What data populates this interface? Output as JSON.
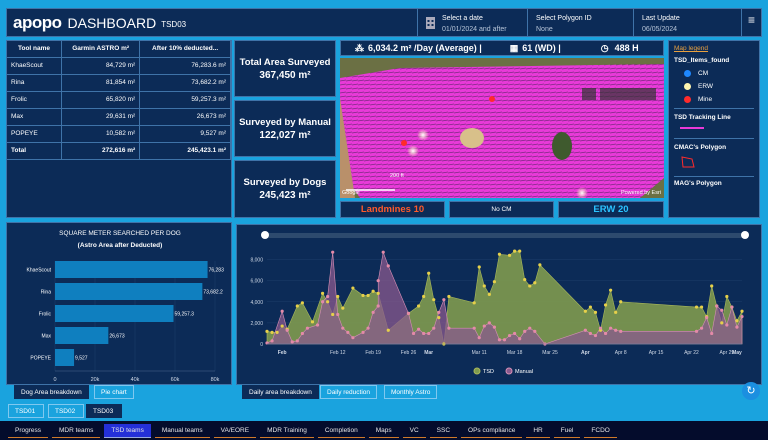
{
  "header": {
    "logo": "apopo",
    "title": "DASHBOARD",
    "subtitle": "TSD03",
    "date_label": "Select a date",
    "date_value": "01/01/2024 and after",
    "polygon_label": "Select Polygon ID",
    "polygon_value": "None",
    "update_label": "Last Update",
    "update_value": "06/05/2024"
  },
  "table": {
    "headers": [
      "Tool name",
      "Garmin ASTRO m²",
      "After 10% deducted..."
    ],
    "rows": [
      [
        "KhaeScout",
        "84,729 m²",
        "76,283.6 m²"
      ],
      [
        "Rina",
        "81,854 m²",
        "73,682.2 m²"
      ],
      [
        "Frolic",
        "65,820 m²",
        "59,257.3 m²"
      ],
      [
        "Max",
        "29,631 m²",
        "26,673 m²"
      ],
      [
        "POPEYE",
        "10,582 m²",
        "9,527 m²"
      ]
    ],
    "total": [
      "Total",
      "272,616 m²",
      "245,423.1 m²"
    ]
  },
  "kpis": [
    {
      "label": "Total Area Surveyed",
      "value": "367,450 m²"
    },
    {
      "label": "Surveyed by Manual",
      "value": "122,027 m²"
    },
    {
      "label": "Surveyed by Dogs",
      "value": "245,423 m²"
    }
  ],
  "stats": {
    "avg": "6,034.2 m² /Day (Average) |",
    "wd": "61 (WD) |",
    "hours": "488 H"
  },
  "map": {
    "scale": "200 ft",
    "attribution_left": "Google",
    "attribution_right": "Powered by Esri"
  },
  "counters": {
    "landmines": "Landmines 10",
    "cm": "No CM",
    "erw": "ERW 20",
    "landmine_color": "#ff5a2a",
    "erw_color": "#2bc2ff"
  },
  "legend": {
    "title": "Map legend",
    "items_title": "TSD_Items_found",
    "items": [
      {
        "label": "CM",
        "color": "#1e88ff"
      },
      {
        "label": "ERW",
        "color": "#fff6b0"
      },
      {
        "label": "Mine",
        "color": "#ff2b2b"
      }
    ],
    "tracking_title": "TSD Tracking Line",
    "polygon_title": "CMAC's Polygon",
    "next_title": "MAG's Polygon"
  },
  "chart_data": [
    {
      "type": "bar",
      "title": "SQUARE METER SEARCHED PER DOG",
      "subtitle": "(Astro Area after Deducted)",
      "categories": [
        "KhaeScout",
        "Rina",
        "Frolic",
        "Max",
        "POPEYE"
      ],
      "values": [
        76283,
        73682.2,
        59257.3,
        26673,
        9527
      ],
      "value_labels": [
        "76,283",
        "73,682.2",
        "59,257.3",
        "26,673",
        "9,527"
      ],
      "xlim": [
        0,
        80000
      ],
      "ticks": [
        "0",
        "20k",
        "40k",
        "60k",
        "80k"
      ],
      "orientation": "horizontal",
      "color": "#0f7fbf"
    },
    {
      "type": "area",
      "xlim": [
        "2024-01-29",
        "2024-05-02"
      ],
      "ylim": [
        0,
        9000
      ],
      "yticks": [
        "0",
        "2,000",
        "4,000",
        "6,000",
        "8,000"
      ],
      "xticks": [
        {
          "date": "2024-02-01",
          "label": "Feb",
          "bold": true
        },
        {
          "date": "2024-02-12",
          "label": "Feb 12"
        },
        {
          "date": "2024-02-19",
          "label": "Feb 19"
        },
        {
          "date": "2024-02-26",
          "label": "Feb 26"
        },
        {
          "date": "2024-03-01",
          "label": "Mar",
          "bold": true
        },
        {
          "date": "2024-03-11",
          "label": "Mar 11"
        },
        {
          "date": "2024-03-18",
          "label": "Mar 18"
        },
        {
          "date": "2024-03-25",
          "label": "Mar 25"
        },
        {
          "date": "2024-04-01",
          "label": "Apr",
          "bold": true
        },
        {
          "date": "2024-04-08",
          "label": "Apr 8"
        },
        {
          "date": "2024-04-15",
          "label": "Apr 15"
        },
        {
          "date": "2024-04-22",
          "label": "Apr 22"
        },
        {
          "date": "2024-04-29",
          "label": "Apr 29"
        },
        {
          "date": "2024-05-01",
          "label": "May",
          "bold": true
        }
      ],
      "series": [
        {
          "name": "TSD",
          "color": "#7f9a4f",
          "points": [
            [
              "2024-01-29",
              1200
            ],
            [
              "2024-01-30",
              1100
            ],
            [
              "2024-01-31",
              1100
            ],
            [
              "2024-02-01",
              1700
            ],
            [
              "2024-02-02",
              1400
            ],
            [
              "2024-02-04",
              3600
            ],
            [
              "2024-02-05",
              3900
            ],
            [
              "2024-02-07",
              2100
            ],
            [
              "2024-02-09",
              4800
            ],
            [
              "2024-02-10",
              4000
            ],
            [
              "2024-02-11",
              2800
            ],
            [
              "2024-02-12",
              4500
            ],
            [
              "2024-02-13",
              3400
            ],
            [
              "2024-02-15",
              5300
            ],
            [
              "2024-02-17",
              4600
            ],
            [
              "2024-02-18",
              4600
            ],
            [
              "2024-02-19",
              5000
            ],
            [
              "2024-02-20",
              4800
            ],
            [
              "2024-02-22",
              1300
            ],
            [
              "2024-02-26",
              2900
            ],
            [
              "2024-02-28",
              3600
            ],
            [
              "2024-02-29",
              4500
            ],
            [
              "2024-03-01",
              6700
            ],
            [
              "2024-03-02",
              4200
            ],
            [
              "2024-03-03",
              2500
            ],
            [
              "2024-03-04",
              0
            ],
            [
              "2024-03-05",
              4500
            ],
            [
              "2024-03-10",
              3900
            ],
            [
              "2024-03-11",
              7300
            ],
            [
              "2024-03-12",
              5500
            ],
            [
              "2024-03-13",
              4700
            ],
            [
              "2024-03-14",
              5900
            ],
            [
              "2024-03-15",
              8500
            ],
            [
              "2024-03-17",
              8400
            ],
            [
              "2024-03-18",
              8800
            ],
            [
              "2024-03-19",
              8800
            ],
            [
              "2024-03-20",
              6100
            ],
            [
              "2024-03-21",
              5500
            ],
            [
              "2024-03-22",
              5800
            ],
            [
              "2024-03-23",
              7500
            ],
            [
              "2024-04-01",
              3100
            ],
            [
              "2024-04-02",
              3500
            ],
            [
              "2024-04-03",
              3000
            ],
            [
              "2024-04-04",
              1300
            ],
            [
              "2024-04-05",
              3700
            ],
            [
              "2024-04-06",
              5100
            ],
            [
              "2024-04-07",
              3000
            ],
            [
              "2024-04-08",
              4000
            ],
            [
              "2024-04-23",
              3500
            ],
            [
              "2024-04-24",
              3500
            ],
            [
              "2024-04-25",
              2600
            ],
            [
              "2024-04-26",
              5500
            ],
            [
              "2024-04-27",
              3600
            ],
            [
              "2024-04-28",
              2000
            ],
            [
              "2024-04-29",
              4500
            ],
            [
              "2024-04-30",
              3500
            ],
            [
              "2024-05-01",
              2200
            ],
            [
              "2024-05-02",
              3100
            ]
          ]
        },
        {
          "name": "Manual",
          "color": "#8a5a8e",
          "points": [
            [
              "2024-01-29",
              100
            ],
            [
              "2024-01-30",
              300
            ],
            [
              "2024-02-01",
              3100
            ],
            [
              "2024-02-02",
              1300
            ],
            [
              "2024-02-03",
              200
            ],
            [
              "2024-02-04",
              300
            ],
            [
              "2024-02-05",
              1000
            ],
            [
              "2024-02-06",
              1500
            ],
            [
              "2024-02-08",
              1800
            ],
            [
              "2024-02-09",
              4000
            ],
            [
              "2024-02-10",
              4500
            ],
            [
              "2024-02-11",
              8700
            ],
            [
              "2024-02-12",
              2800
            ],
            [
              "2024-02-13",
              1500
            ],
            [
              "2024-02-14",
              1100
            ],
            [
              "2024-02-15",
              600
            ],
            [
              "2024-02-17",
              1100
            ],
            [
              "2024-02-18",
              1500
            ],
            [
              "2024-02-19",
              3000
            ],
            [
              "2024-02-20",
              3600
            ],
            [
              "2024-02-20",
              6000
            ],
            [
              "2024-02-21",
              8700
            ],
            [
              "2024-02-22",
              7400
            ],
            [
              "2024-02-26",
              2900
            ],
            [
              "2024-02-27",
              1000
            ],
            [
              "2024-02-28",
              1400
            ],
            [
              "2024-02-29",
              1000
            ],
            [
              "2024-03-01",
              1000
            ],
            [
              "2024-03-02",
              1500
            ],
            [
              "2024-03-03",
              3000
            ],
            [
              "2024-03-04",
              4200
            ],
            [
              "2024-03-05",
              1500
            ],
            [
              "2024-03-10",
              1500
            ],
            [
              "2024-03-11",
              600
            ],
            [
              "2024-03-12",
              1700
            ],
            [
              "2024-03-13",
              2000
            ],
            [
              "2024-03-14",
              1600
            ],
            [
              "2024-03-15",
              400
            ],
            [
              "2024-03-16",
              400
            ],
            [
              "2024-03-17",
              800
            ],
            [
              "2024-03-18",
              1000
            ],
            [
              "2024-03-19",
              500
            ],
            [
              "2024-03-20",
              1200
            ],
            [
              "2024-03-21",
              1500
            ],
            [
              "2024-03-22",
              1200
            ],
            [
              "2024-03-24",
              0
            ],
            [
              "2024-04-01",
              1300
            ],
            [
              "2024-04-02",
              1000
            ],
            [
              "2024-04-03",
              800
            ],
            [
              "2024-04-04",
              1500
            ],
            [
              "2024-04-05",
              1000
            ],
            [
              "2024-04-06",
              1500
            ],
            [
              "2024-04-07",
              1300
            ],
            [
              "2024-04-08",
              1200
            ],
            [
              "2024-04-23",
              1200
            ],
            [
              "2024-04-24",
              1500
            ],
            [
              "2024-04-25",
              2500
            ],
            [
              "2024-04-26",
              1000
            ],
            [
              "2024-04-27",
              3600
            ],
            [
              "2024-04-28",
              3200
            ],
            [
              "2024-04-29",
              1800
            ],
            [
              "2024-04-30",
              3500
            ],
            [
              "2024-05-01",
              1600
            ],
            [
              "2024-05-02",
              2600
            ]
          ]
        }
      ]
    }
  ],
  "left_tabs": [
    "Dog Area breakdown",
    "Pie chart"
  ],
  "right_tabs": [
    "Daily area breakdown",
    "Daily reduction",
    "Monthly Astro"
  ],
  "tsd_tabs": [
    "TSD01",
    "TSD02",
    "TSD03"
  ],
  "nav": [
    "Progress",
    "MDR teams",
    "TSD teams",
    "Manual teams",
    "VA/EORE",
    "MDR Training",
    "Completion",
    "Maps",
    "VC",
    "SSC",
    "OPs compliance",
    "HR",
    "Fuel",
    "FCDO"
  ]
}
